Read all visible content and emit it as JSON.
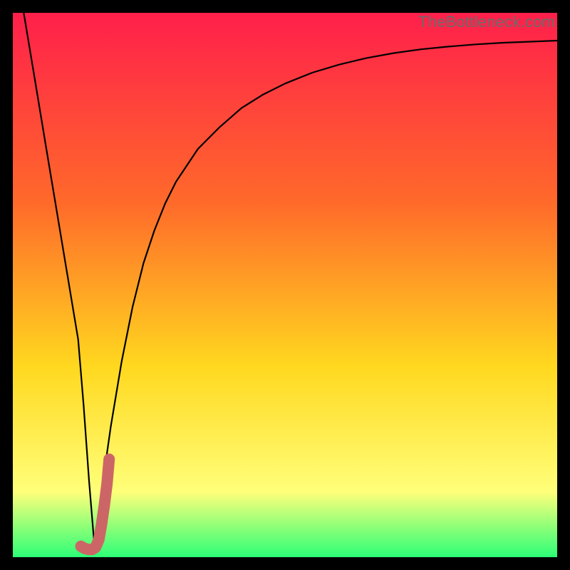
{
  "watermark": "TheBottleneck.com",
  "colors": {
    "gradient_top": "#ff1f4b",
    "gradient_mid1": "#ff6a2a",
    "gradient_mid2": "#ffd81f",
    "gradient_mid3": "#ffff7a",
    "gradient_bottom": "#2cff77",
    "curve": "#000000",
    "marker": "#cc6666",
    "frame": "#000000"
  },
  "chart_data": {
    "type": "line",
    "title": "",
    "xlabel": "",
    "ylabel": "",
    "xlim": [
      0,
      100
    ],
    "ylim": [
      0,
      100
    ],
    "grid": false,
    "series": [
      {
        "name": "bottleneck-curve",
        "x": [
          2,
          4,
          6,
          8,
          10,
          12,
          13,
          14,
          15,
          16,
          18,
          20,
          22,
          24,
          26,
          28,
          30,
          34,
          38,
          42,
          46,
          50,
          55,
          60,
          65,
          70,
          75,
          80,
          85,
          90,
          95,
          100
        ],
        "values": [
          100,
          88,
          76,
          64,
          52,
          40,
          28,
          14,
          2,
          10,
          24,
          36,
          46,
          54,
          60,
          65,
          69,
          75,
          79,
          82.5,
          85,
          87,
          89,
          90.5,
          91.7,
          92.6,
          93.3,
          93.8,
          94.2,
          94.5,
          94.7,
          94.9
        ]
      }
    ],
    "marker": {
      "name": "j-marker",
      "x": [
        12.5,
        13.2,
        14.0,
        14.6,
        15.2,
        15.8,
        16.3,
        16.8,
        17.3,
        17.7
      ],
      "values": [
        2.0,
        1.6,
        1.4,
        1.4,
        1.8,
        3.2,
        6.0,
        9.5,
        13.5,
        18.0
      ]
    }
  }
}
